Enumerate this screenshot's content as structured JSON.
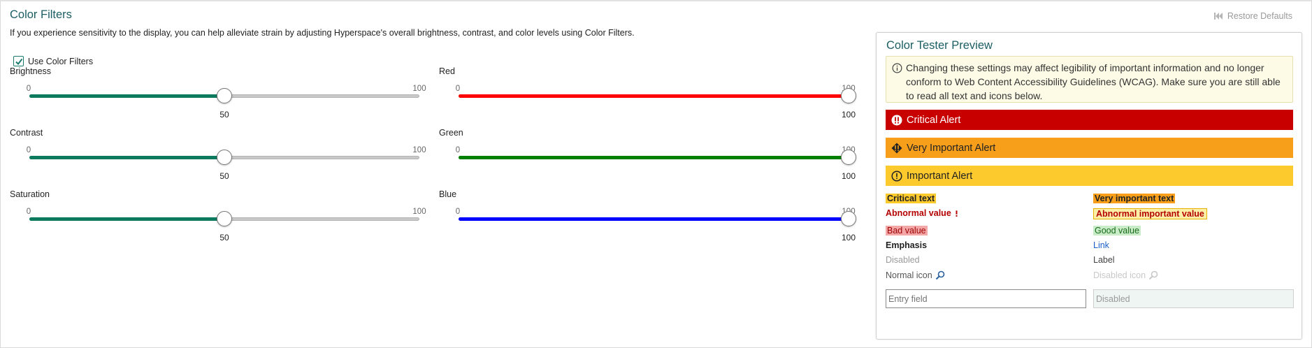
{
  "page": {
    "title": "Color Filters",
    "intro": "If you experience sensitivity to the display, you can help alleviate strain by adjusting Hyperspace's overall brightness, contrast, and color levels using Color Filters.",
    "restore_label": "Restore Defaults"
  },
  "use_filters": {
    "label": "Use Color Filters",
    "checked": true
  },
  "sliders": [
    {
      "label": "Brightness",
      "min": "0",
      "max": "100",
      "value": 50,
      "value_text": "50",
      "color": "#0b7a5f"
    },
    {
      "label": "Contrast",
      "min": "0",
      "max": "100",
      "value": 50,
      "value_text": "50",
      "color": "#0b7a5f"
    },
    {
      "label": "Saturation",
      "min": "0",
      "max": "100",
      "value": 50,
      "value_text": "50",
      "color": "#0b7a5f"
    },
    {
      "label": "Red",
      "min": "0",
      "max": "100",
      "value": 100,
      "value_text": "100",
      "color": "#ff0000"
    },
    {
      "label": "Green",
      "min": "0",
      "max": "100",
      "value": 100,
      "value_text": "100",
      "color": "#008000"
    },
    {
      "label": "Blue",
      "min": "0",
      "max": "100",
      "value": 100,
      "value_text": "100",
      "color": "#0000ff"
    }
  ],
  "preview": {
    "title": "Color Tester Preview",
    "notice": "Changing these settings may affect legibility of important information and no longer conform to Web Content Accessibility Guidelines (WCAG). Make sure you are still able to read all text and icons below.",
    "critical_alert": "Critical Alert",
    "very_important_alert": "Very Important Alert",
    "important_alert": "Important Alert",
    "critical_text": "Critical text",
    "very_important_text": "Very important text",
    "abnormal_value": "Abnormal value",
    "abnormal_important_value": "Abnormal important value",
    "bad_value": "Bad value",
    "good_value": "Good value",
    "emphasis": "Emphasis",
    "link": "Link",
    "disabled": "Disabled",
    "label": "Label",
    "normal_icon": "Normal icon",
    "disabled_icon": "Disabled icon",
    "entry_placeholder": "Entry field",
    "disabled_field_value": "Disabled"
  },
  "colors": {
    "accent": "#1b5e63",
    "critical": "#c80000",
    "very_important": "#f79e1b",
    "important": "#fdca2e"
  }
}
